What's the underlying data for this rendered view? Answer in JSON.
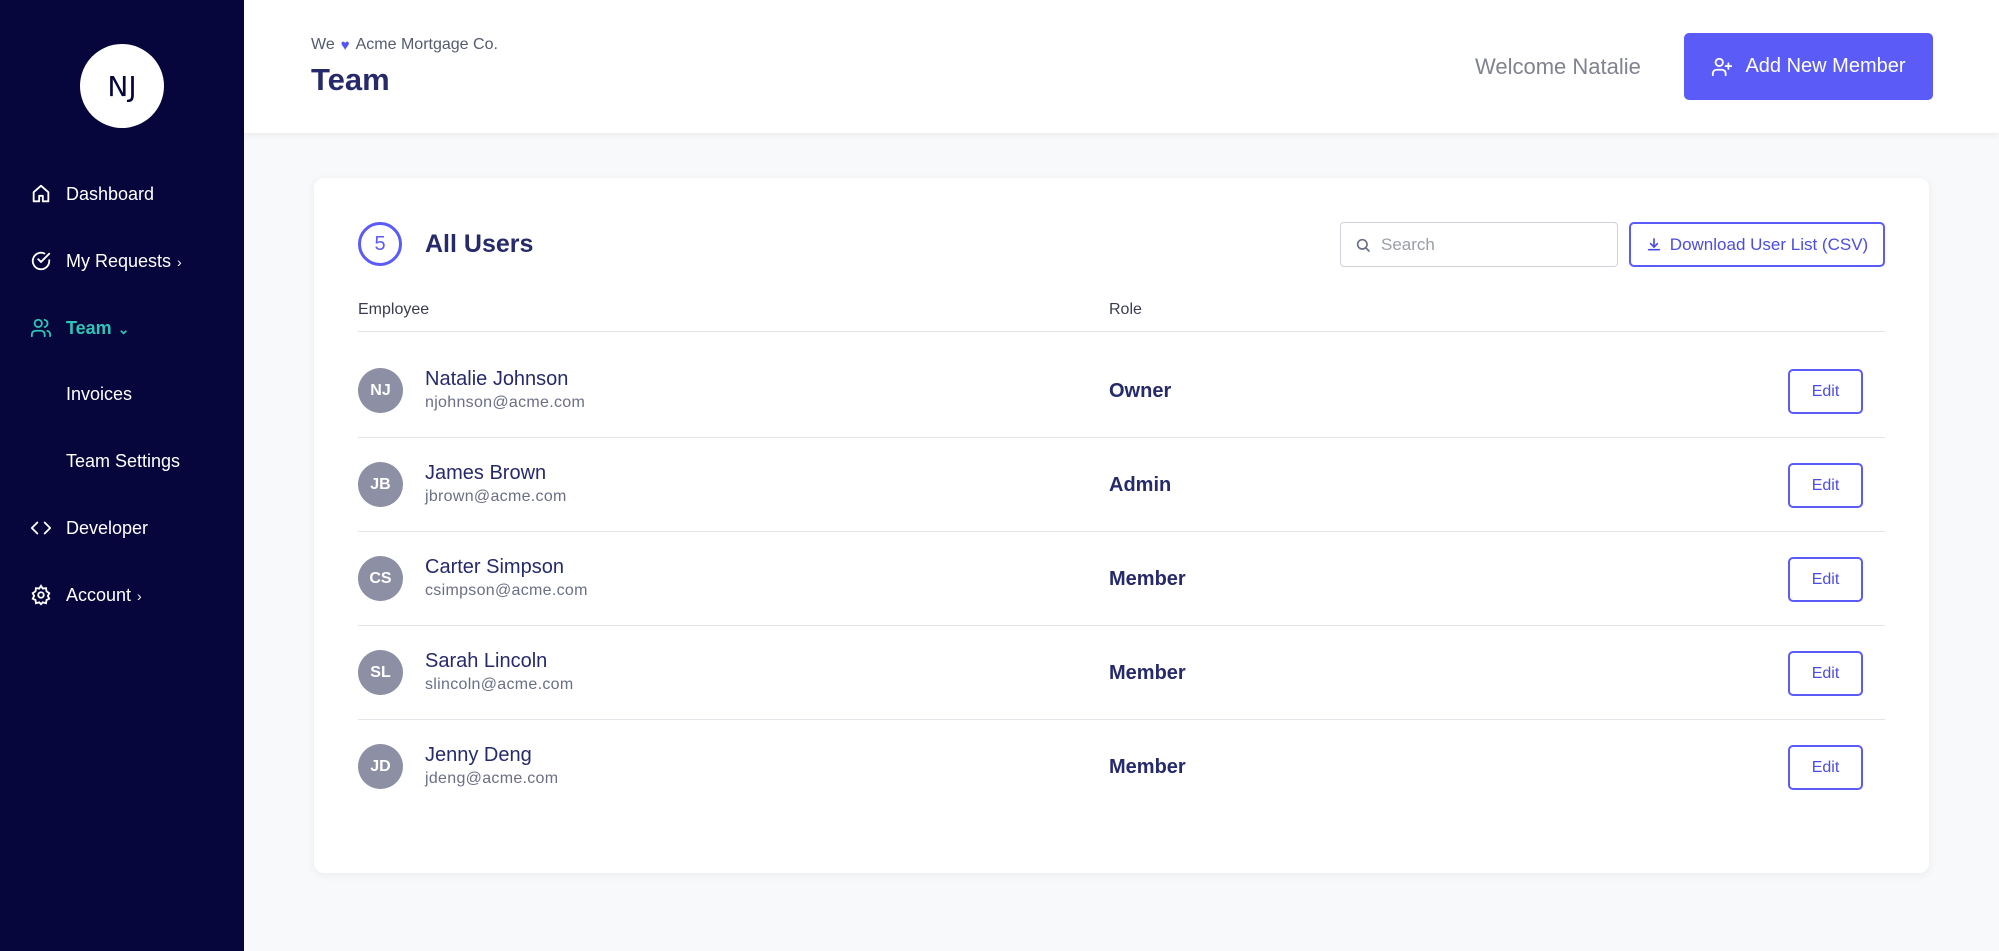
{
  "sidebar": {
    "avatar_initials": "NJ",
    "items": [
      {
        "label": "Dashboard",
        "icon": "home-icon"
      },
      {
        "label": "My Requests",
        "icon": "check-circle-icon",
        "chevron": "›"
      },
      {
        "label": "Team",
        "icon": "users-icon",
        "chevron": "⌄",
        "active": true
      },
      {
        "label": "Developer",
        "icon": "code-icon"
      },
      {
        "label": "Account",
        "icon": "gear-icon",
        "chevron": "›"
      }
    ],
    "sub_items": [
      "Invoices",
      "Team Settings"
    ]
  },
  "header": {
    "crumb_prefix": "We",
    "crumb_heart": "♥",
    "company": "Acme Mortgage Co.",
    "title": "Team",
    "welcome": "Welcome Natalie",
    "add_button": "Add New Member"
  },
  "users_panel": {
    "count": "5",
    "title": "All Users",
    "search_placeholder": "Search",
    "download_button": "Download User List (CSV)",
    "columns": {
      "employee": "Employee",
      "role": "Role"
    },
    "edit_label": "Edit",
    "rows": [
      {
        "initials": "NJ",
        "name": "Natalie Johnson",
        "email": "njohnson@acme.com",
        "role": "Owner"
      },
      {
        "initials": "JB",
        "name": "James Brown",
        "email": "jbrown@acme.com",
        "role": "Admin"
      },
      {
        "initials": "CS",
        "name": "Carter Simpson",
        "email": "csimpson@acme.com",
        "role": "Member"
      },
      {
        "initials": "SL",
        "name": "Sarah Lincoln",
        "email": "slincoln@acme.com",
        "role": "Member"
      },
      {
        "initials": "JD",
        "name": "Jenny Deng",
        "email": "jdeng@acme.com",
        "role": "Member"
      }
    ]
  },
  "colors": {
    "sidebar_bg": "#06063d",
    "accent": "#5b5bf8",
    "active_nav": "#2ec4b6",
    "heading": "#262a6a"
  }
}
